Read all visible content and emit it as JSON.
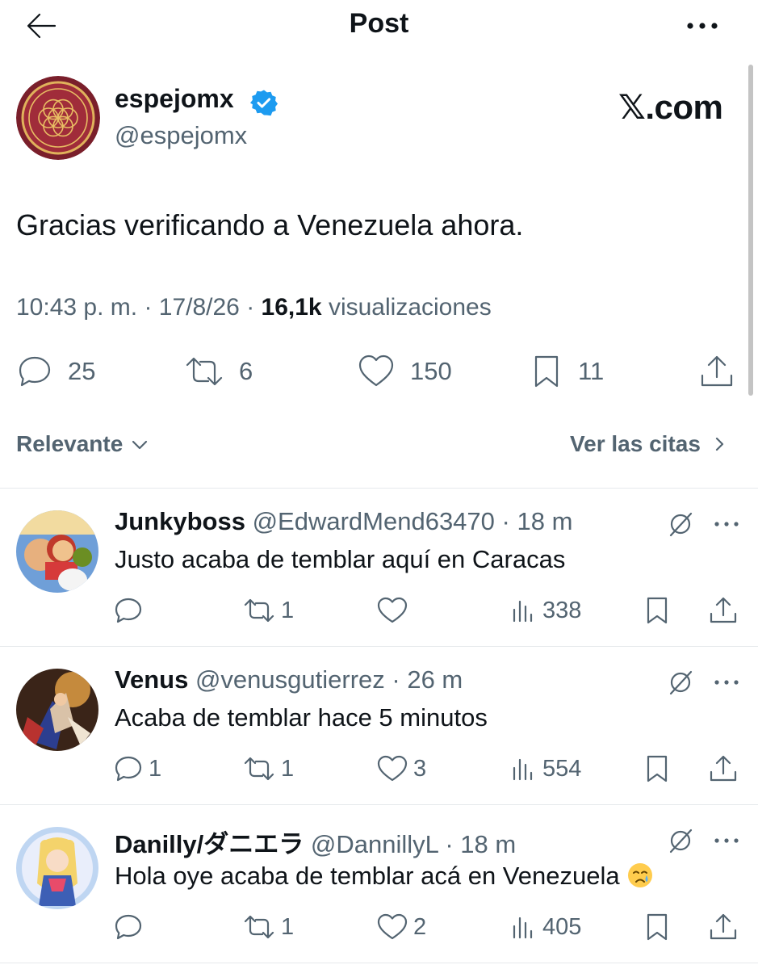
{
  "header": {
    "title": "Post"
  },
  "post": {
    "name": "espejomx",
    "handle": "@espejomx",
    "brand": "𝕏.com",
    "text": "Gracias verificando a Venezuela ahora.",
    "time": "10:43 p. m.",
    "date": "17/8/26",
    "views_count": "16,1k",
    "views_label": "visualizaciones",
    "replies": "25",
    "reposts": "6",
    "likes": "150",
    "bookmarks": "11"
  },
  "sort": {
    "label": "Relevante",
    "quotes_label": "Ver las citas"
  },
  "replies": [
    {
      "name": "Junkyboss",
      "handle": "@EdwardMend63470",
      "time": "18 m",
      "text": "Justo acaba de temblar aquí en Caracas",
      "replies": "",
      "reposts": "1",
      "likes": "",
      "views": "338"
    },
    {
      "name": "Venus",
      "handle": "@venusgutierrez",
      "time": "26 m",
      "text": "Acaba de temblar hace 5 minutos",
      "replies": "1",
      "reposts": "1",
      "likes": "3",
      "views": "554"
    },
    {
      "name": "Danilly/ダニエラ",
      "handle": "@DannillyL",
      "time": "18 m",
      "text": "Hola oye acaba de temblar acá en Venezuela",
      "replies": "",
      "reposts": "1",
      "likes": "2",
      "views": "405"
    }
  ],
  "colors": {
    "text": "#0f1419",
    "secondary": "#536471",
    "verified": "#1d9bf0",
    "divider": "#e6e9ec"
  },
  "icons": [
    "back-arrow-icon",
    "more-icon",
    "verified-badge-icon",
    "reply-icon",
    "repost-icon",
    "like-icon",
    "bookmark-icon",
    "share-icon",
    "views-icon",
    "grok-icon",
    "chevron-down-icon",
    "chevron-right-icon",
    "crying-face-emoji"
  ]
}
